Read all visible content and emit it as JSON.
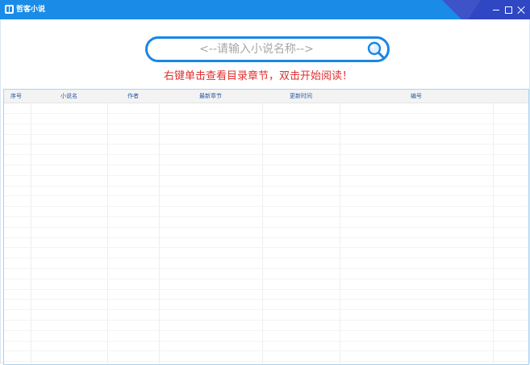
{
  "window": {
    "title": "哲客小说",
    "icon": "book-icon",
    "controls": [
      "minimize-icon",
      "maximize-icon",
      "close-icon"
    ]
  },
  "search": {
    "placeholder": "<--请输入小说名称-->",
    "value": "",
    "button_icon": "magnifier-icon"
  },
  "hint": "右键单击查看目录章节，双击开始阅读！",
  "table": {
    "columns": [
      "序号",
      "小说名",
      "作者",
      "最新章节",
      "更新时间",
      "编号"
    ],
    "rows": []
  },
  "colors": {
    "titlebar": "#1a8ce8",
    "accent": "#1a86e6",
    "hint_text": "#e03030",
    "header_text": "#2a5aa0"
  }
}
